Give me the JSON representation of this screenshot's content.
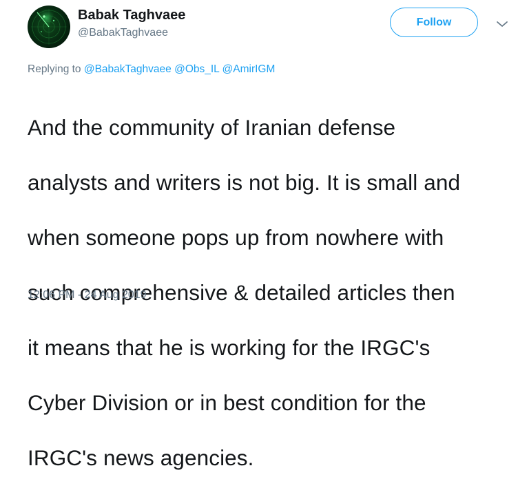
{
  "author": {
    "display_name": "Babak Taghvaee",
    "handle": "@BabakTaghvaee",
    "avatar_icon": "radar-avatar-icon"
  },
  "actions": {
    "follow_label": "Follow",
    "more_icon": "chevron-down-icon"
  },
  "reply_context": {
    "prefix": "Replying to",
    "mentions": [
      "@BabakTaghvaee",
      "@Obs_IL",
      "@AmirIGM"
    ]
  },
  "tweet": {
    "text_lines": [
      "And the community of Iranian defense",
      "analysts and writers is not big. It is small and",
      "when someone pops up from nowhere with",
      "such comprehensive & detailed articles then",
      "it means that he is working for the IRGC's",
      "Cyber Division or in best condition for the",
      "IRGC's news agencies."
    ],
    "timestamp": "12:06 PM - 24 Aug 2019"
  },
  "colors": {
    "accent": "#1da1f2",
    "text_primary": "#14171a",
    "text_secondary": "#657786"
  }
}
